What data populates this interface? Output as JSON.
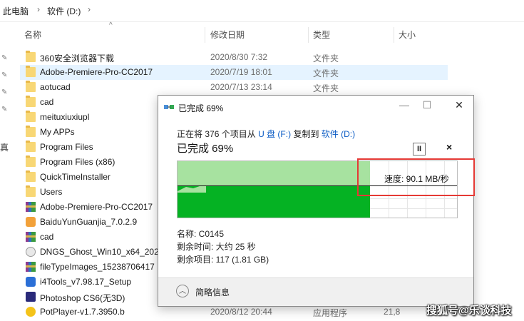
{
  "breadcrumb": {
    "items": [
      "此电脑",
      "软件 (D:)"
    ]
  },
  "nav": {
    "partial_label": "真"
  },
  "columns": {
    "name": "名称",
    "modified": "修改日期",
    "type": "类型",
    "size": "大小"
  },
  "files": [
    {
      "name": "360安全浏览器下载",
      "date": "2020/8/30 7:32",
      "type": "文件夹",
      "size": "",
      "icon": "folder"
    },
    {
      "name": "Adobe-Premiere-Pro-CC2017",
      "date": "2020/7/19 18:01",
      "type": "文件夹",
      "size": "",
      "icon": "folder",
      "selected": true
    },
    {
      "name": "aotucad",
      "date": "2020/7/13 23:14",
      "type": "文件夹",
      "size": "",
      "icon": "folder"
    },
    {
      "name": "cad",
      "date": "",
      "type": "",
      "size": "",
      "icon": "folder"
    },
    {
      "name": "meituxiuxiupl",
      "date": "",
      "type": "",
      "size": "",
      "icon": "folder"
    },
    {
      "name": "My APPs",
      "date": "",
      "type": "",
      "size": "",
      "icon": "folder"
    },
    {
      "name": "Program Files",
      "date": "",
      "type": "",
      "size": "",
      "icon": "folder"
    },
    {
      "name": "Program Files (x86)",
      "date": "",
      "type": "",
      "size": "",
      "icon": "folder"
    },
    {
      "name": "QuickTimeInstaller",
      "date": "",
      "type": "",
      "size": "",
      "icon": "folder"
    },
    {
      "name": "Users",
      "date": "",
      "type": "",
      "size": "",
      "icon": "folder"
    },
    {
      "name": "Adobe-Premiere-Pro-CC2017",
      "date": "",
      "type": "",
      "size": "",
      "icon": "rar"
    },
    {
      "name": "BaiduYunGuanjia_7.0.2.9",
      "date": "",
      "type": "",
      "size": "",
      "icon": "exe-baidu"
    },
    {
      "name": "cad",
      "date": "",
      "type": "",
      "size": "",
      "icon": "rar"
    },
    {
      "name": "DNGS_Ghost_Win10_x64_202",
      "date": "",
      "type": "",
      "size": "",
      "icon": "exe-iso"
    },
    {
      "name": "fileTypeImages_15238706417",
      "date": "",
      "type": "",
      "size": "",
      "icon": "rar"
    },
    {
      "name": "i4Tools_v7.98.17_Setup",
      "date": "",
      "type": "",
      "size": "",
      "icon": "exe-i4"
    },
    {
      "name": "Photoshop CS6(无3D)",
      "date": "",
      "type": "",
      "size": "",
      "icon": "exe-ps"
    },
    {
      "name": "PotPlayer-v1.7.3950.b",
      "date": "2020/8/12 20:44",
      "type": "应用程序",
      "size": "21,8",
      "icon": "exe-pot"
    }
  ],
  "dialog": {
    "title": "已完成 69%",
    "line_prefix": "正在将",
    "item_count": "376",
    "line_mid": "个项目从",
    "source": "U 盘 (F:)",
    "line_to": "复制到",
    "destination": "软件 (D:)",
    "progress_label": "已完成 69%",
    "progress": 0.69,
    "speed": "速度: 90.1 MB/秒",
    "name_line": "名称:  C0145",
    "time_left": "剩余时间:  大约 25 秒",
    "items_left": "剩余项目:  117 (1.81 GB)",
    "simple_info": "简略信息",
    "pause_glyph": "II",
    "cancel_glyph": "×",
    "win_min": "—",
    "win_max": "☐",
    "win_close": "✕"
  },
  "watermark": "搜狐号@乐谈科技"
}
